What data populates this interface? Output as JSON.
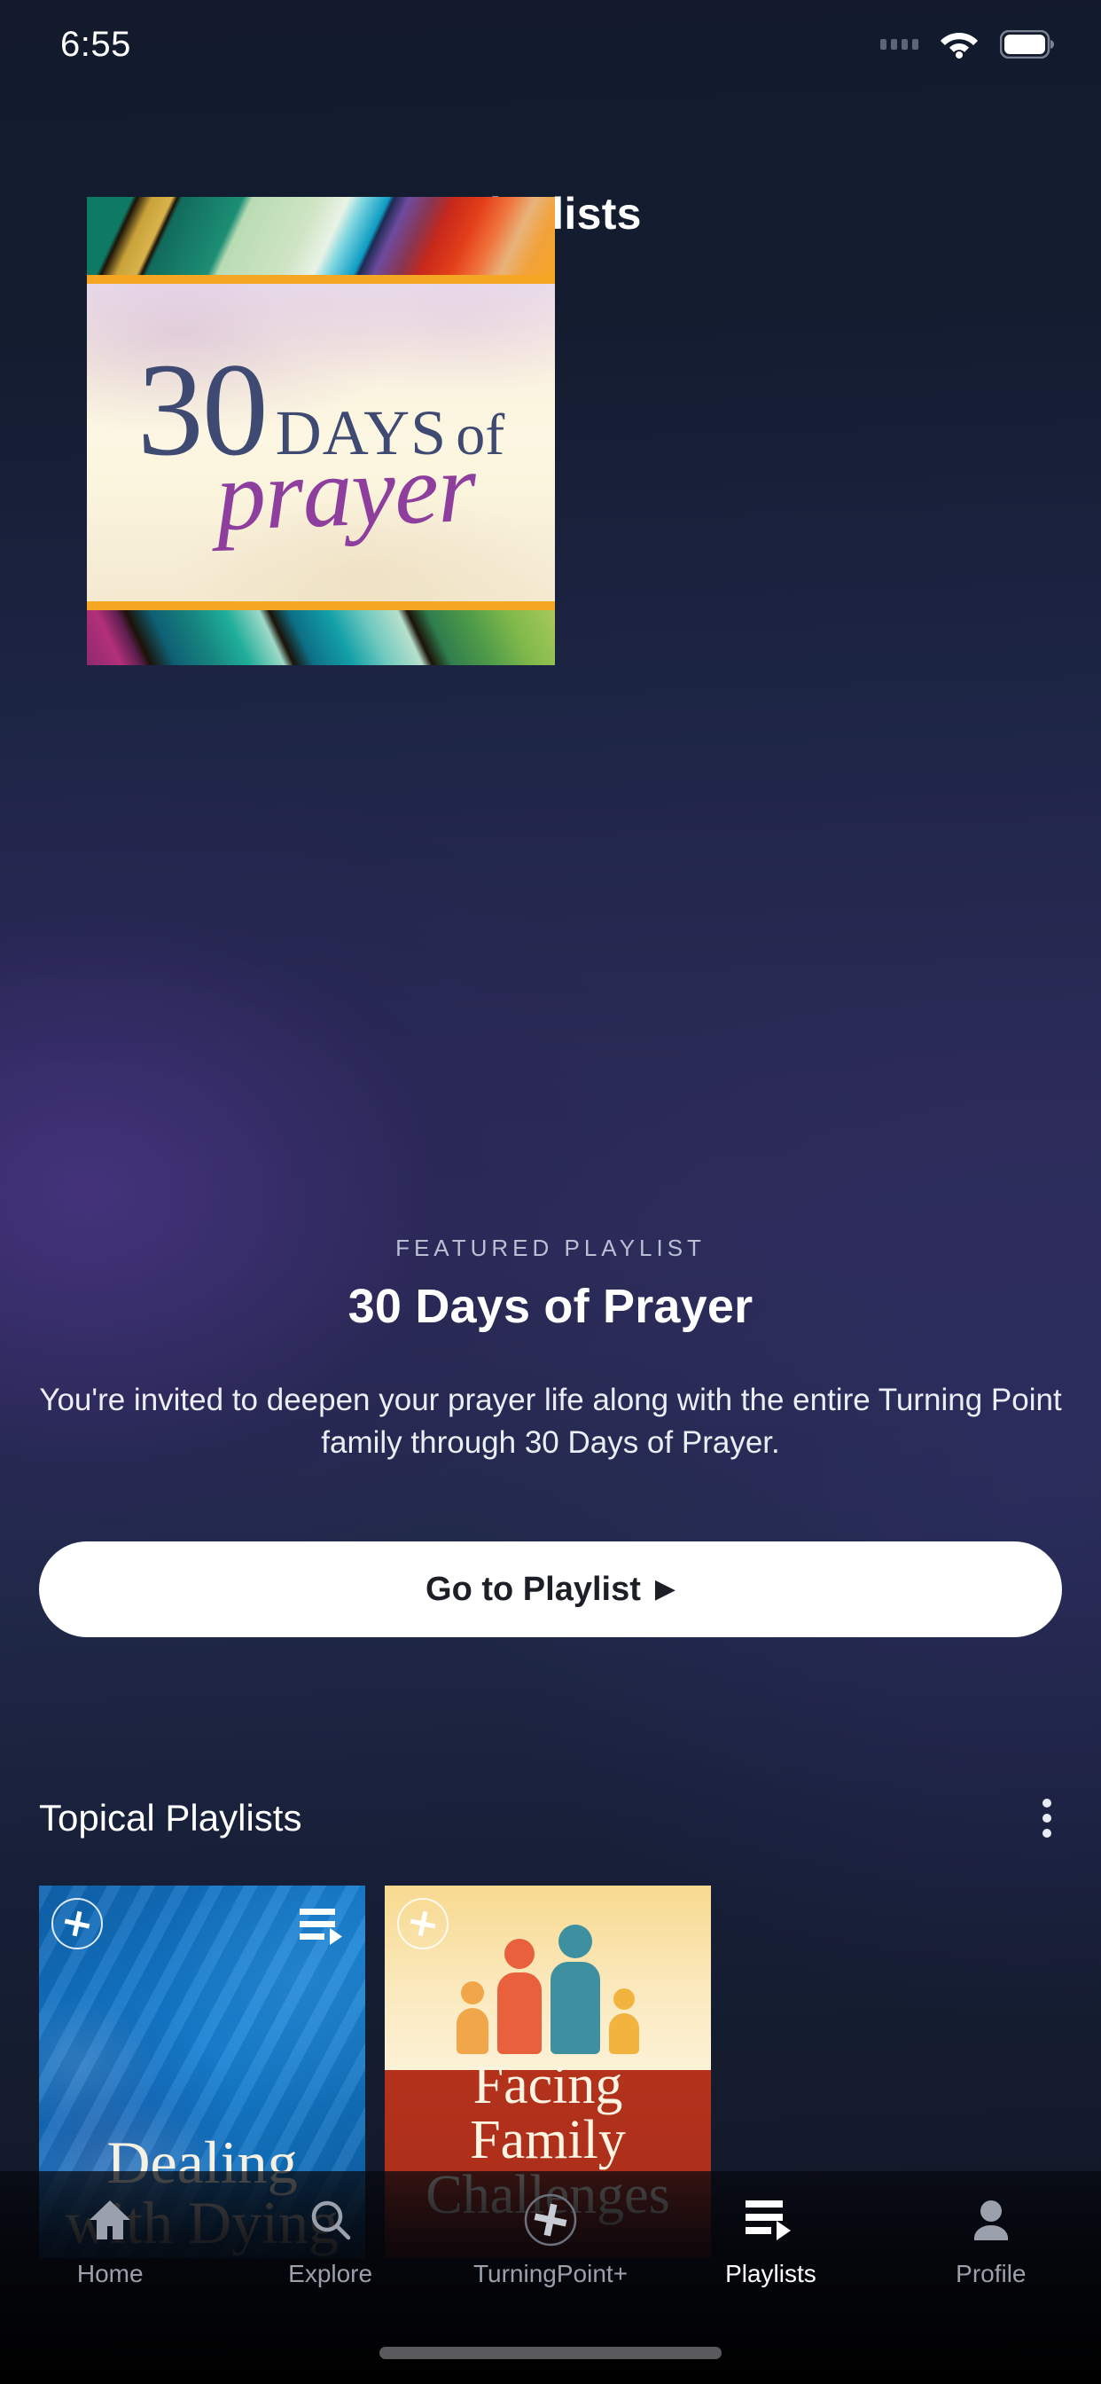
{
  "status_bar": {
    "time": "6:55",
    "signal_icon": "signal-dots-icon",
    "wifi_icon": "wifi-icon",
    "battery_icon": "battery-icon"
  },
  "header": {
    "title": "Playlists"
  },
  "featured": {
    "artwork": {
      "number": "30",
      "days": "DAYS",
      "of": "of",
      "script": "prayer"
    },
    "eyebrow": "FEATURED PLAYLIST",
    "title": "30 Days of Prayer",
    "description": "You're invited to deepen your prayer life along with the entire Turning Point family through 30 Days of Prayer.",
    "cta_label": "Go to Playlist",
    "cta_arrow": "▶"
  },
  "topical": {
    "section_title": "Topical Playlists",
    "overflow_icon": "kebab-menu-icon",
    "cards": [
      {
        "title": "Dealing with Dying",
        "add_icon": "circle-plus-icon",
        "playlist_icon": "playlist-icon",
        "accent": "#1581d4"
      },
      {
        "title": "Facing Family Challenges",
        "add_icon": "circle-plus-icon",
        "playlist_icon": "playlist-icon",
        "accent": "#b4321c"
      }
    ]
  },
  "tabbar": {
    "items": [
      {
        "label": "Home",
        "icon": "home-icon",
        "active": false
      },
      {
        "label": "Explore",
        "icon": "search-icon",
        "active": false
      },
      {
        "label": "TurningPoint+",
        "icon": "plus-circle-icon",
        "active": false
      },
      {
        "label": "Playlists",
        "icon": "playlist-icon",
        "active": true
      },
      {
        "label": "Profile",
        "icon": "person-icon",
        "active": false
      }
    ]
  },
  "colors": {
    "background_top": "#121a2c",
    "background_mid": "#2c2b58",
    "accent_white": "#ffffff",
    "artwork_navy": "#3f4a72",
    "artwork_purple": "#8e3f9e",
    "artwork_gold": "#f5a623"
  }
}
